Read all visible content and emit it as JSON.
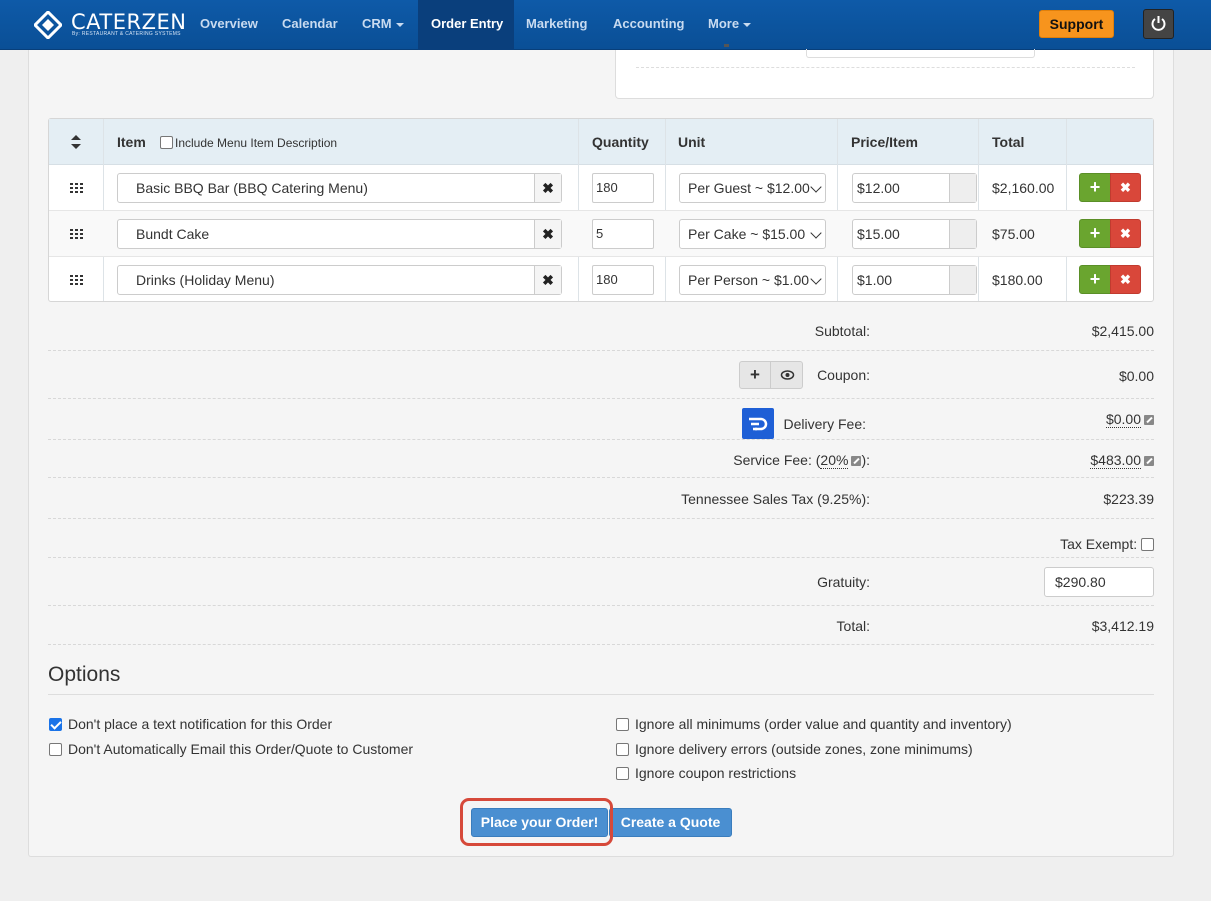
{
  "nav": {
    "logo_text": "CATERZEN",
    "logo_sub": "By: RESTAURANT & CATERING SYSTEMS",
    "items": [
      {
        "label": "Overview",
        "dropdown": false,
        "active": false
      },
      {
        "label": "Calendar",
        "dropdown": false,
        "active": false
      },
      {
        "label": "CRM",
        "dropdown": true,
        "active": false
      },
      {
        "label": "Order Entry",
        "dropdown": false,
        "active": true
      },
      {
        "label": "Marketing",
        "dropdown": false,
        "active": false
      },
      {
        "label": "Accounting",
        "dropdown": false,
        "active": false
      },
      {
        "label": "More",
        "dropdown": true,
        "active": false
      }
    ],
    "support_label": "Support",
    "power_icon": "power-icon"
  },
  "items_table": {
    "headers": {
      "item": "Item",
      "include_desc": "Include Menu Item Description",
      "quantity": "Quantity",
      "unit": "Unit",
      "price": "Price/Item",
      "total": "Total"
    },
    "rows": [
      {
        "item": "Basic BBQ Bar (BBQ Catering Menu)",
        "quantity": "180",
        "unit": "Per Guest ~ $12.00",
        "price": "$12.00",
        "total": "$2,160.00"
      },
      {
        "item": "Bundt Cake",
        "quantity": "5",
        "unit": "Per Cake ~ $15.00",
        "price": "$15.00",
        "total": "$75.00"
      },
      {
        "item": "Drinks (Holiday Menu)",
        "quantity": "180",
        "unit": "Per Person ~ $1.00",
        "price": "$1.00",
        "total": "$180.00"
      }
    ]
  },
  "totals": {
    "subtotal_label": "Subtotal:",
    "subtotal": "$2,415.00",
    "coupon_label": "Coupon:",
    "coupon": "$0.00",
    "delivery_label": "Delivery Fee:",
    "delivery": "$0.00",
    "service_label_pre": "Service Fee: (",
    "service_pct": "20%",
    "service_label_post": "):",
    "service": "$483.00",
    "tax_label": "Tennessee Sales Tax (9.25%):",
    "tax": "$223.39",
    "tax_exempt_label": "Tax Exempt:",
    "gratuity_label": "Gratuity:",
    "gratuity": "$290.80",
    "total_label": "Total:",
    "total": "$3,412.19"
  },
  "options": {
    "title": "Options",
    "left": [
      {
        "label": "Don't place a text notification for this Order",
        "checked": true
      },
      {
        "label": "Don't Automatically Email this Order/Quote to Customer",
        "checked": false
      }
    ],
    "right": [
      {
        "label": "Ignore all minimums (order value and quantity and inventory)",
        "checked": false
      },
      {
        "label": "Ignore delivery errors (outside zones, zone minimums)",
        "checked": false
      },
      {
        "label": "Ignore coupon restrictions",
        "checked": false
      }
    ]
  },
  "actions": {
    "place_order": "Place your Order!",
    "create_quote": "Create a Quote"
  },
  "colors": {
    "nav_bg": "#0e5aa8",
    "support": "#f7941d",
    "primary": "#4a8fd1",
    "add": "#6aa52f",
    "remove": "#d9473a",
    "highlight": "#d6493a"
  }
}
